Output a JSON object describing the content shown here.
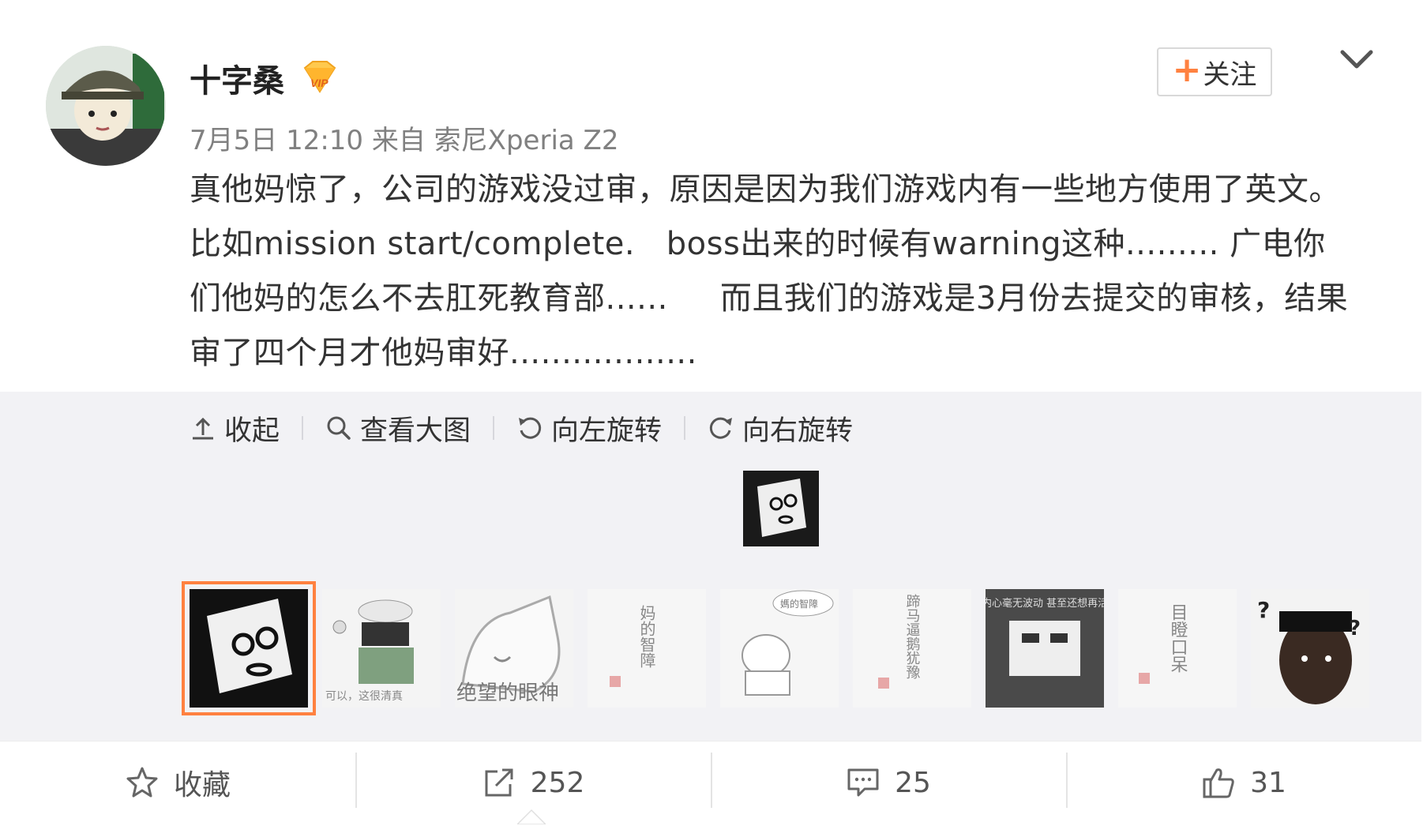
{
  "post": {
    "author": "十字桑",
    "vip_badge_icon": "vip-diamond-icon",
    "meta": "7月5日 12:10 来自 索尼Xperia Z2",
    "follow_label": "关注",
    "text": "真他妈惊了，公司的游戏没过审，原因是因为我们游戏内有一些地方使用了英文。比如mission start/complete.   boss出来的时候有warning这种......... 广电你们他妈的怎么不去肛死教育部......     而且我们的游戏是3月份去提交的审核，结果审了四个月才他妈审好.................."
  },
  "media_toolbar": {
    "collapse": "收起",
    "view_large": "查看大图",
    "rotate_left": "向左旋转",
    "rotate_right": "向右旋转"
  },
  "thumbnails": [
    {
      "caption": "",
      "selected": true
    },
    {
      "caption": "可以，这很清真"
    },
    {
      "caption": "绝望的眼神"
    },
    {
      "caption": "妈的智障"
    },
    {
      "caption": "媽的智障"
    },
    {
      "caption": "蹄马逼鹅犹豫"
    },
    {
      "caption": "我的内心毫无波动 甚至还想再活一秒",
      "dark": true
    },
    {
      "caption": "目瞪口呆"
    },
    {
      "caption": "?"
    }
  ],
  "actions": {
    "favorite": "收藏",
    "repost": "252",
    "comment": "25",
    "like": "31"
  },
  "colors": {
    "accent_orange": "#ff8140",
    "toolbar_bg": "#f2f2f5",
    "meta_gray": "#808080"
  }
}
